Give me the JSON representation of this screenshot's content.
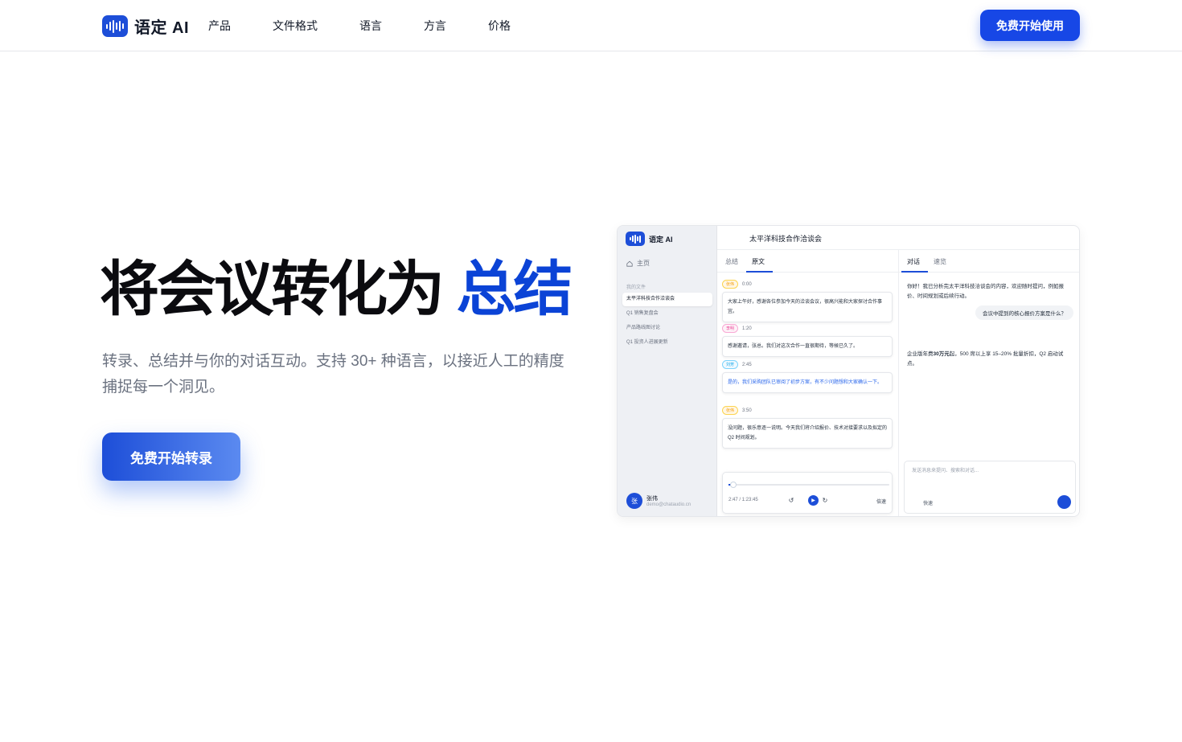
{
  "brand": {
    "name": "语定 AI",
    "accent_color": "#1d4ed8"
  },
  "nav": {
    "items": [
      "产品",
      "文件格式",
      "语言",
      "方言",
      "价格"
    ]
  },
  "header_cta": "免费开始使用",
  "hero": {
    "title_main": "将会议转化为",
    "title_accent": "总结",
    "subtitle": "转录、总结并与你的对话互动。支持 30+ 种语言，以接近人工的精度捕捉每一个洞见。",
    "cta": "免费开始转录"
  },
  "app": {
    "brand": "语定 AI",
    "home": "主页",
    "section_label": "我的文件",
    "files": [
      "太平洋科技合作洽谈会",
      "Q1 销售复盘会",
      "产品路线图讨论",
      "Q1 投资人进展更新"
    ],
    "active_file_index": 0,
    "user": {
      "avatar": "张",
      "name": "张伟",
      "email": "demo@chataudio.cn"
    },
    "doc_title": "太平洋科技合作洽谈会",
    "tabs_mid": [
      "总结",
      "原文"
    ],
    "active_mid_tab": "原文",
    "transcript": [
      {
        "speaker": "张伟",
        "color": "orange",
        "time": "0:00",
        "text": "大家上午好，感谢各位参加今天的洽谈会议，很高兴能和大家探讨合作事宜。"
      },
      {
        "speaker": "李明",
        "color": "pink",
        "time": "1:20",
        "text": "感谢邀请，张总。我们对这次合作一直很期待，等候已久了。"
      },
      {
        "speaker": "刘芳",
        "color": "blue",
        "time": "2:45",
        "text": "是的，我们采购团队已审阅了初步方案，有不少问题想和大家确认一下。"
      },
      {
        "speaker": "张伟",
        "color": "orange",
        "time": "3:50",
        "text": "没问题，很乐意逐一说明。今天我们将介绍报价、技术对接要求以及拟定的 Q2 时间规划。"
      }
    ],
    "player": {
      "time": "2:47 / 1:23:45",
      "speed": "倍速",
      "progress": 0.03
    },
    "tabs_right": [
      "对话",
      "速览"
    ],
    "active_right_tab": "对话",
    "chat": {
      "ai_intro": "你好！我已分析完太平洋科技洽谈会的内容，欢迎随时提问，例如报价、时间规划或后续行动。",
      "user_question": "会议中提到的核心报价方案是什么？",
      "answer_prefix": "企业版年费",
      "answer_bold": "30万元",
      "answer_suffix": "起，500 席以上享 15–20% 批量折扣，Q2 启动试点。",
      "input_placeholder": "发送消息来提问、搜索和对话...",
      "mode_label": "快速"
    }
  }
}
